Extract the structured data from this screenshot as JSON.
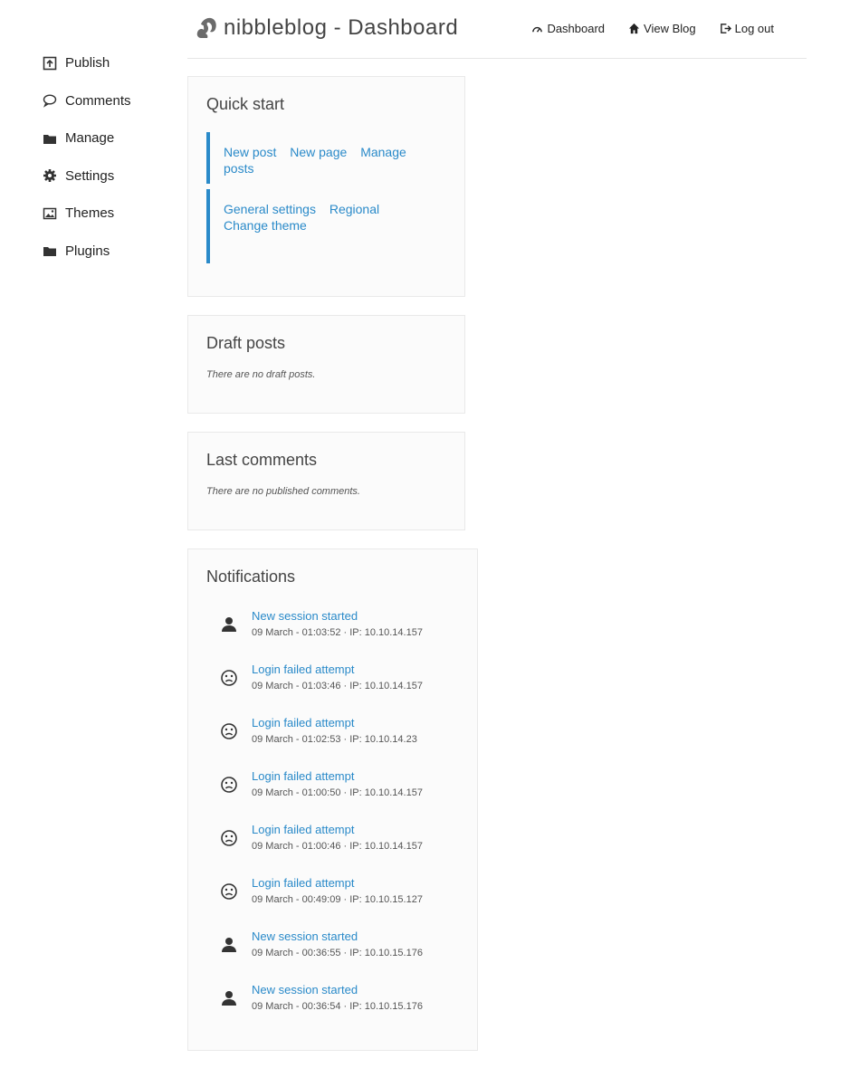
{
  "header": {
    "title": "nibbleblog - Dashboard",
    "nav": [
      {
        "label": "Dashboard",
        "icon": "dashboard-icon"
      },
      {
        "label": "View Blog",
        "icon": "home-icon"
      },
      {
        "label": "Log out",
        "icon": "logout-icon"
      }
    ]
  },
  "sidebar": {
    "items": [
      {
        "label": "Publish",
        "icon": "publish-icon"
      },
      {
        "label": "Comments",
        "icon": "comments-icon"
      },
      {
        "label": "Manage",
        "icon": "folder-icon"
      },
      {
        "label": "Settings",
        "icon": "gear-icon"
      },
      {
        "label": "Themes",
        "icon": "image-icon"
      },
      {
        "label": "Plugins",
        "icon": "folder-icon"
      }
    ]
  },
  "quick_start": {
    "title": "Quick start",
    "links_group_1": [
      "New post",
      "New page",
      "Manage posts"
    ],
    "links_group_2": [
      "General settings",
      "Regional",
      "Change theme"
    ]
  },
  "draft_posts": {
    "title": "Draft posts",
    "empty": "There are no draft posts."
  },
  "last_comments": {
    "title": "Last comments",
    "empty": "There are no published comments."
  },
  "notifications": {
    "title": "Notifications",
    "items": [
      {
        "title": "New session started",
        "meta": "09 March - 01:03:52 · IP: 10.10.14.157",
        "icon": "user-icon"
      },
      {
        "title": "Login failed attempt",
        "meta": "09 March - 01:03:46 · IP: 10.10.14.157",
        "icon": "sad-face-icon"
      },
      {
        "title": "Login failed attempt",
        "meta": "09 March - 01:02:53 · IP: 10.10.14.23",
        "icon": "sad-face-icon"
      },
      {
        "title": "Login failed attempt",
        "meta": "09 March - 01:00:50 · IP: 10.10.14.157",
        "icon": "sad-face-icon"
      },
      {
        "title": "Login failed attempt",
        "meta": "09 March - 01:00:46 · IP: 10.10.14.157",
        "icon": "sad-face-icon"
      },
      {
        "title": "Login failed attempt",
        "meta": "09 March - 00:49:09 · IP: 10.10.15.127",
        "icon": "sad-face-icon"
      },
      {
        "title": "New session started",
        "meta": "09 March - 00:36:55 · IP: 10.10.15.176",
        "icon": "user-icon"
      },
      {
        "title": "New session started",
        "meta": "09 March - 00:36:54 · IP: 10.10.15.176",
        "icon": "user-icon"
      }
    ]
  },
  "colors": {
    "link": "#2a8ac9",
    "accent_bar": "#2a8ac9",
    "box_bg": "#fbfbfb"
  }
}
